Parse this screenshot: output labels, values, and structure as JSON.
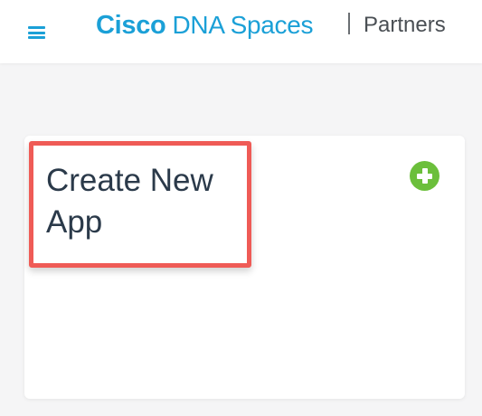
{
  "header": {
    "menu_icon": "hamburger-menu-icon",
    "brand_bold": "Cisco",
    "brand_light": "DNA Spaces",
    "section": "Partners"
  },
  "card": {
    "title": "Create New App",
    "add_icon": "plus-circle-icon"
  },
  "colors": {
    "brand": "#1ba0d7",
    "add_icon": "#6bbf3b",
    "highlight": "#ef5b56",
    "background": "#f5f5f6"
  }
}
